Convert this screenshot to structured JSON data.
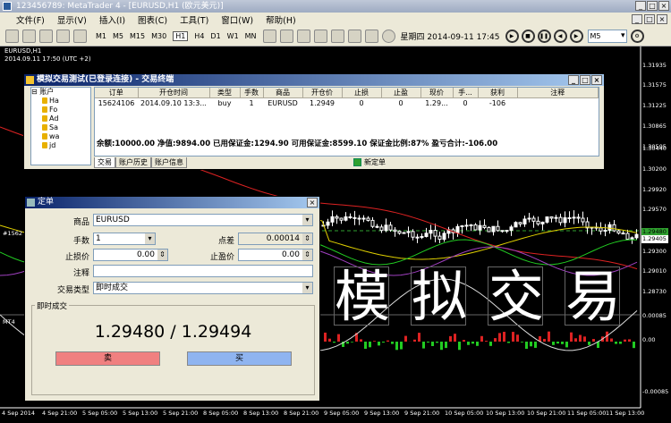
{
  "window": {
    "title": "123456789: MetaTrader 4 - [EURUSD,H1 (欧元美元)]"
  },
  "menu": [
    "文件(F)",
    "显示(V)",
    "插入(I)",
    "图表(C)",
    "工具(T)",
    "窗口(W)",
    "帮助(H)"
  ],
  "toolbar": {
    "timeframes": [
      "M1",
      "M5",
      "M15",
      "M30",
      "H1",
      "H4",
      "D1",
      "W1",
      "MN"
    ],
    "active_timeframe": "H1",
    "datetime": "星期四 2014-09-11 17:45",
    "period_select": "M5"
  },
  "chart": {
    "symbol": "EURUSD,H1",
    "subtitle": "2014.09.11 17:50 (UTC +2)",
    "indicator_label": "MT4",
    "order_marker": "#1562",
    "y_ticks": [
      "1.31935",
      "1.31575",
      "1.31225",
      "1.30865",
      "1.30505",
      "1.30440",
      "1.30200",
      "1.29920",
      "1.29570",
      "1.29480",
      "1.29300",
      "1.29010",
      "1.28730",
      "0.00085",
      "0.00",
      "-0.00085"
    ],
    "price_tag_1": "1.29480",
    "price_tag_2": "1.29405",
    "x_ticks": [
      "4 Sep 2014",
      "4 Sep 21:00",
      "5 Sep 05:00",
      "5 Sep 13:00",
      "5 Sep 21:00",
      "8 Sep 05:00",
      "8 Sep 13:00",
      "8 Sep 21:00",
      "9 Sep 05:00",
      "9 Sep 13:00",
      "9 Sep 21:00",
      "10 Sep 05:00",
      "10 Sep 13:00",
      "10 Sep 21:00",
      "11 Sep 05:00",
      "11 Sep 13:00"
    ]
  },
  "terminal": {
    "title": "模拟交易测试(已登录连接)  - 交易终端",
    "tree": [
      "账户",
      "Ha",
      "Fo",
      "Ad",
      "Sa",
      "wa",
      "jd"
    ],
    "columns": [
      "订单",
      "开仓时间",
      "类型",
      "手数",
      "商品",
      "开仓价",
      "止损",
      "止盈",
      "现价",
      "手...",
      "获利",
      "注释"
    ],
    "rows": [
      [
        "15624106",
        "2014.09.10 13:3...",
        "buy",
        "1",
        "EURUSD",
        "1.2949",
        "0",
        "0",
        "1.29...",
        "0",
        "-106",
        ""
      ]
    ],
    "summary": "余额:10000.00  净值:9894.00  已用保证金:1294.90  可用保证金:8599.10  保证金比例:87%  盈亏合计:-106.00",
    "tabs": [
      "交易",
      "账户历史",
      "账户信息"
    ],
    "new_order": "新定单"
  },
  "order_dialog": {
    "title": "定单",
    "symbol_label": "商品",
    "symbol_value": "EURUSD",
    "volume_label": "手数",
    "volume_value": "1",
    "spread_label": "点差",
    "spread_value": "0.00014",
    "sl_label": "止损价",
    "sl_value": "0.00",
    "tp_label": "止盈价",
    "tp_value": "0.00",
    "comment_label": "注释",
    "comment_value": "",
    "type_label": "交易类型",
    "type_value": "即时成交",
    "group_label": "即时成交",
    "quote": "1.29480 / 1.29494",
    "sell_label": "卖",
    "buy_label": "买"
  },
  "watermark": [
    "模",
    "拟",
    "交",
    "易"
  ]
}
